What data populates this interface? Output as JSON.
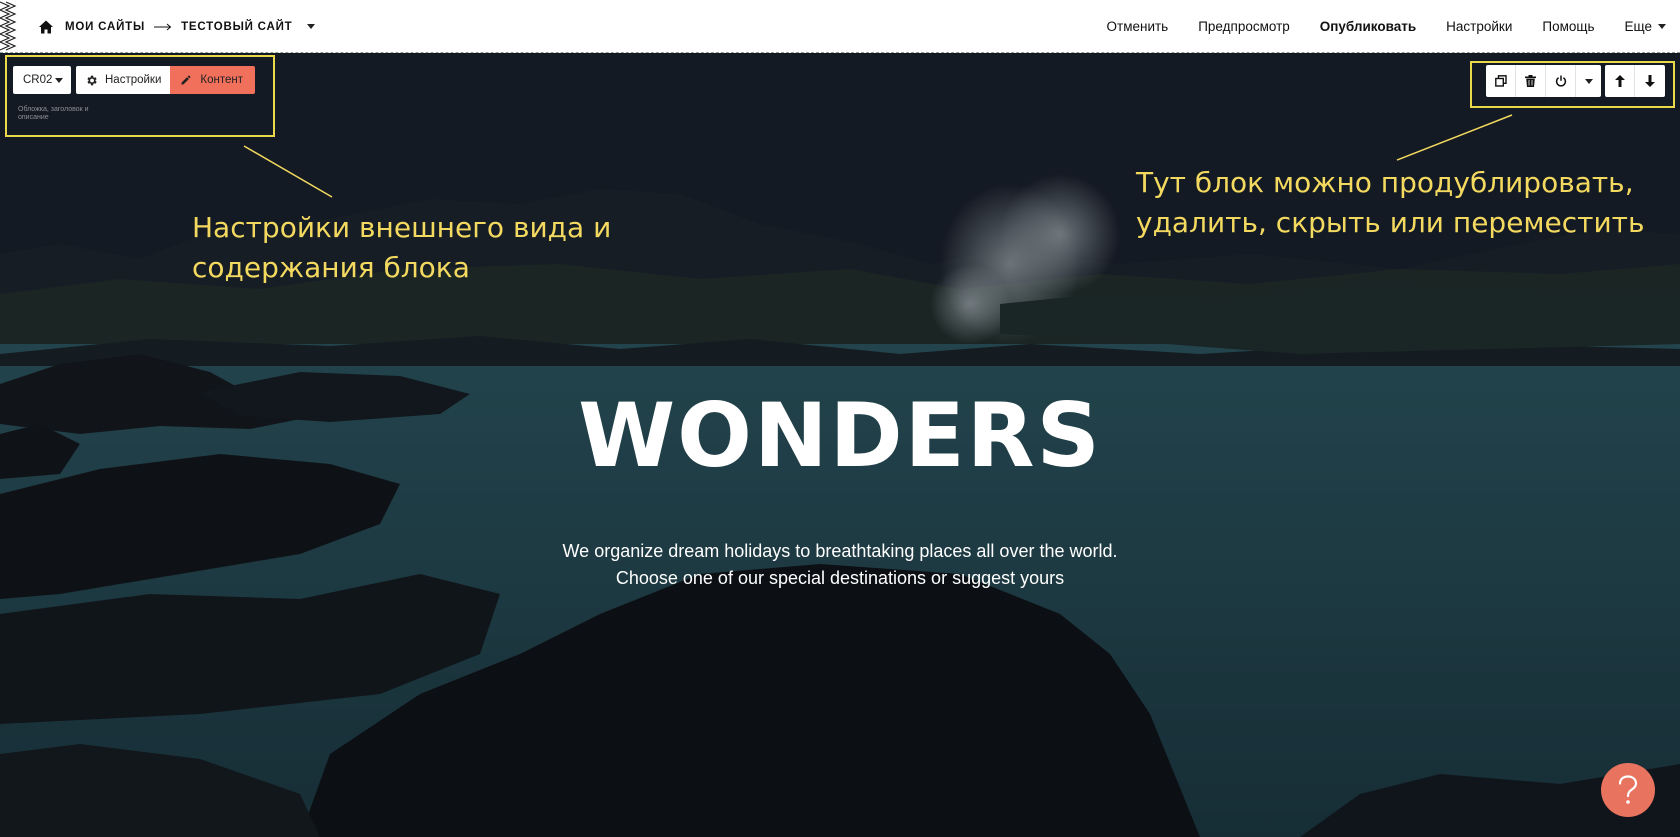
{
  "topbar": {
    "breadcrumbs": [
      {
        "label": "МОИ САЙТЫ"
      },
      {
        "label": "ТЕСТОВЫЙ САЙТ"
      }
    ],
    "nav": {
      "undo": "Отменить",
      "preview": "Предпросмотр",
      "publish": "Опубликовать",
      "settings": "Настройки",
      "help": "Помощь",
      "more": "Еще"
    }
  },
  "block_editor": {
    "block_code": "CR02",
    "settings_label": "Настройки",
    "content_label": "Контент",
    "block_description": "Обложка, заголовок и описание",
    "actions": {
      "duplicate": "duplicate-icon",
      "delete": "trash-icon",
      "toggle": "power-icon",
      "menu": "chevron-down-icon",
      "move_up": "arrow-up-icon",
      "move_down": "arrow-down-icon"
    }
  },
  "hero": {
    "title": "WONDERS",
    "subtitle": "We organize dream holidays to breathtaking places all over the world. Choose one of our special destinations or suggest yours"
  },
  "annotations": {
    "left": "Настройки внешнего вида и содержания блока",
    "right": "Тут блок можно продублировать, удалить, скрыть или переместить"
  },
  "help_button": {
    "symbol": "?"
  },
  "colors": {
    "accent": "#f1705b",
    "annotation": "#f3d95f",
    "help_button": "#e8735e"
  }
}
